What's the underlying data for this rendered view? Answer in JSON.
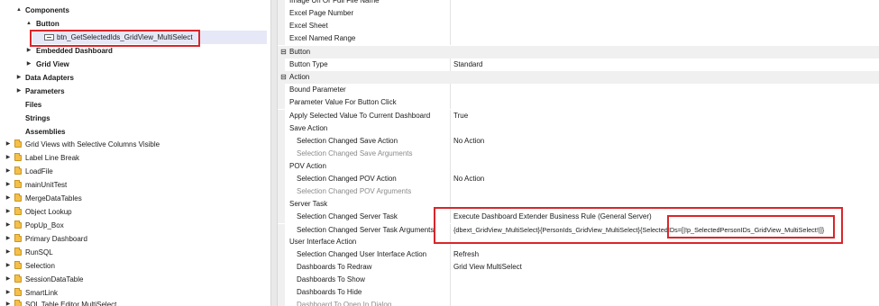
{
  "tree": {
    "components": "Components",
    "button": "Button",
    "selected_item": "btn_GetSelectedIds_GridView_MultiSelect",
    "embedded_dashboard": "Embedded Dashboard",
    "grid_view": "Grid View",
    "data_adapters": "Data Adapters",
    "parameters": "Parameters",
    "files": "Files",
    "strings": "Strings",
    "assemblies": "Assemblies",
    "dashboards": [
      "Grid Views with Selective Columns Visible",
      "Label Line Break",
      "LoadFile",
      "mainUnitTest",
      "MergeDataTables",
      "Object Lookup",
      "PopUp_Box",
      "Primary Dashboard",
      "RunSQL",
      "Selection",
      "SessionDataTable",
      "SmartLink",
      "SQL Table Editor MultiSelect"
    ],
    "collapse_glyph": "▲",
    "expand_glyph": "▶"
  },
  "props": {
    "image_url": "Image Url Or Full File Name",
    "excel_page_number": "Excel Page Number",
    "excel_sheet": "Excel Sheet",
    "excel_named_range": "Excel Named Range",
    "cat_button": "Button",
    "button_type": "Button Type",
    "button_type_value": "Standard",
    "cat_action": "Action",
    "bound_parameter": "Bound Parameter",
    "parameter_value_click": "Parameter Value For Button Click",
    "apply_selected_value": "Apply Selected Value To Current Dashboard",
    "apply_selected_value_value": "True",
    "save_action": "Save Action",
    "sel_changed_save_action": "Selection Changed Save Action",
    "sel_changed_save_action_value": "No Action",
    "sel_changed_save_args": "Selection Changed Save Arguments",
    "pov_action": "POV Action",
    "sel_changed_pov_action": "Selection Changed POV Action",
    "sel_changed_pov_action_value": "No Action",
    "sel_changed_pov_args": "Selection Changed POV Arguments",
    "server_task": "Server Task",
    "sel_changed_server_task": "Selection Changed Server Task",
    "sel_changed_server_task_value": "Execute Dashboard Extender Business Rule (General Server)",
    "sel_changed_server_task_args": "Selection Changed Server Task Arguments",
    "sel_changed_server_task_args_value": "{dbext_GridView_MultiSelect}{PersonIds_GridView_MultiSelect}{SelectedIDs=[|!p_SelectedPersonIDs_GridView_MultiSelect!|]}",
    "ui_action": "User Interface Action",
    "sel_changed_ui_action": "Selection Changed User Interface Action",
    "sel_changed_ui_action_value": "Refresh",
    "dashboards_to_redraw": "Dashboards To Redraw",
    "dashboards_to_redraw_value": "Grid View MultiSelect",
    "dashboards_to_show": "Dashboards To Show",
    "dashboards_to_hide": "Dashboards To Hide",
    "dashboard_to_open_dialog": "Dashboard To Open In Dialog",
    "collapse_glyph": "⊟"
  }
}
